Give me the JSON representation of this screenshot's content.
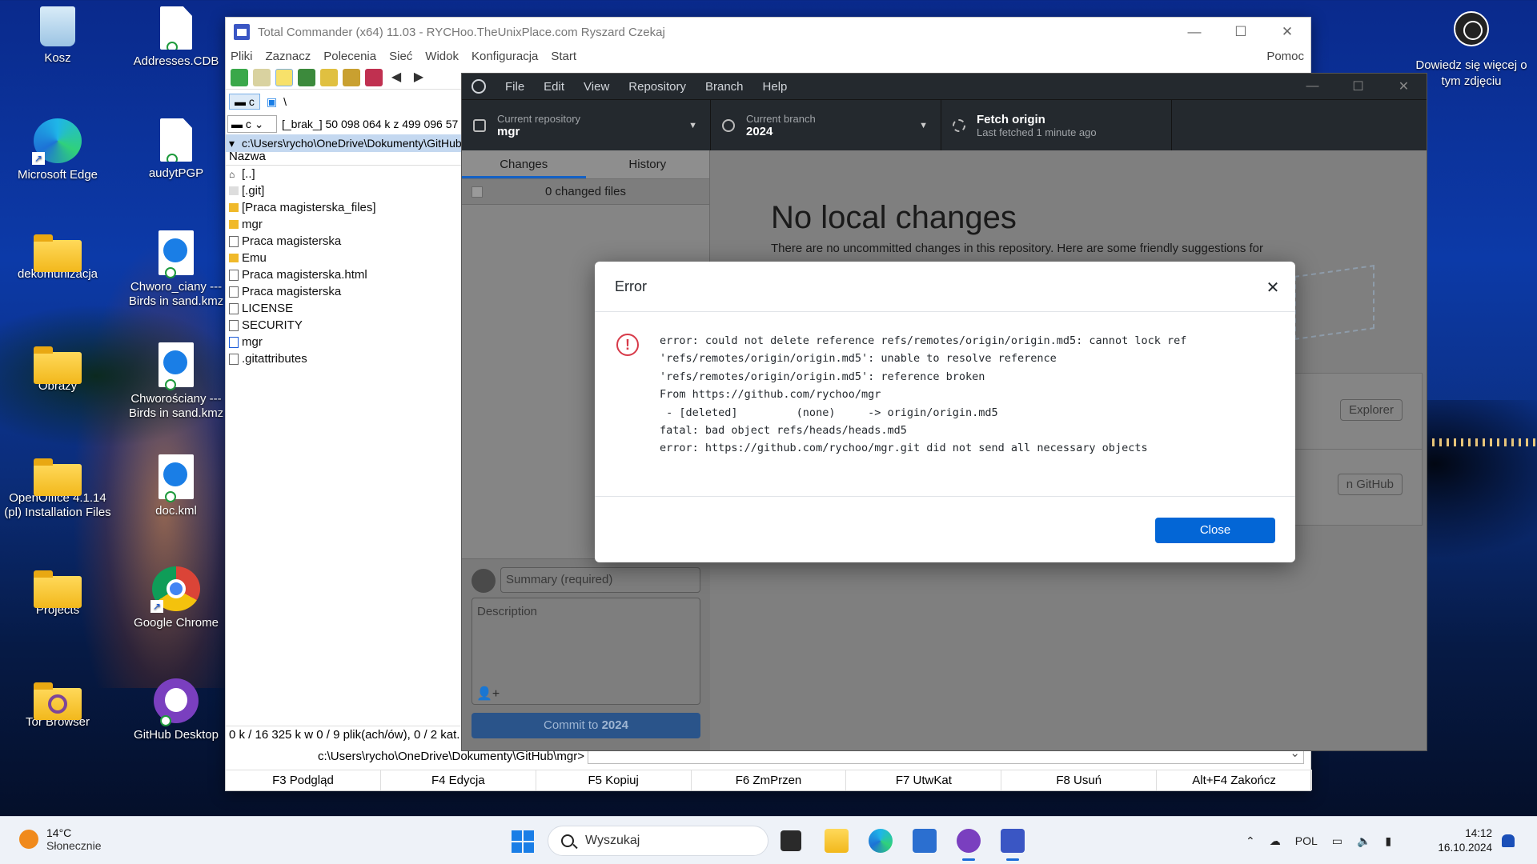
{
  "desktop": {
    "icons": [
      {
        "label": "Kosz",
        "icon": "recycle-bin-icon"
      },
      {
        "label": "Addresses.CDB",
        "icon": "document-icon"
      },
      {
        "label": "Microsoft Edge",
        "icon": "edge-icon"
      },
      {
        "label": "audytPGP",
        "icon": "document-icon"
      },
      {
        "label": "dekomunizacja",
        "icon": "folder-icon"
      },
      {
        "label": "Chworo_ciany --- Birds in sand.kmz",
        "icon": "kmz-icon"
      },
      {
        "label": "Obrazy",
        "icon": "folder-icon"
      },
      {
        "label": "Chworościany --- Birds in sand.kmz",
        "icon": "kmz-icon"
      },
      {
        "label": "OpenOffice 4.1.14 (pl) Installation Files",
        "icon": "folder-icon"
      },
      {
        "label": "doc.kml",
        "icon": "kml-icon"
      },
      {
        "label": "Projects",
        "icon": "folder-icon"
      },
      {
        "label": "Google Chrome",
        "icon": "chrome-icon"
      },
      {
        "label": "Tor Browser",
        "icon": "tor-folder-icon"
      },
      {
        "label": "GitHub Desktop",
        "icon": "github-icon"
      }
    ],
    "spotlight_text": "Dowiedz się więcej o tym zdjęciu"
  },
  "total_commander": {
    "title": "Total Commander (x64) 11.03 - RYCHoo.TheUnixPlace.com Ryszard Czekaj",
    "menu": [
      "Pliki",
      "Zaznacz",
      "Polecenia",
      "Sieć",
      "Widok",
      "Konfiguracja",
      "Start"
    ],
    "menu_right": "Pomoc",
    "drive_button": "c",
    "drive_root": "\\",
    "drive_select": "c",
    "drive_info": "[_brak_]  50 098 064 k z 499 096 57",
    "current_path": "c:\\Users\\rycho\\OneDrive\\Dokumenty\\GitHub\\mgr\\*.*",
    "column_name": "Nazwa",
    "files": [
      {
        "name": "[..]",
        "type": "up"
      },
      {
        "name": "[.git]",
        "type": "folder"
      },
      {
        "name": "[Praca magisterska_files]",
        "type": "folder"
      },
      {
        "name": "mgr",
        "type": "folder"
      },
      {
        "name": "Praca magisterska",
        "type": "file"
      },
      {
        "name": "Emu",
        "type": "folder"
      },
      {
        "name": "Praca magisterska.html",
        "type": "file"
      },
      {
        "name": "Praca magisterska",
        "type": "file"
      },
      {
        "name": "LICENSE",
        "type": "file"
      },
      {
        "name": "SECURITY",
        "type": "file"
      },
      {
        "name": "mgr",
        "type": "file"
      },
      {
        "name": ".gitattributes",
        "type": "file"
      }
    ],
    "status": "0 k / 16 325 k w 0 / 9 plik(ach/ów), 0 / 2 kat.",
    "cmdline_path": "c:\\Users\\rycho\\OneDrive\\Dokumenty\\GitHub\\mgr>",
    "fkeys": [
      "F3 Podgląd",
      "F4 Edycja",
      "F5 Kopiuj",
      "F6 ZmPrzen",
      "F7 UtwKat",
      "F8 Usuń",
      "Alt+F4 Zakończ"
    ]
  },
  "github_desktop": {
    "menu": [
      "File",
      "Edit",
      "View",
      "Repository",
      "Branch",
      "Help"
    ],
    "repo_label": "Current repository",
    "repo_value": "mgr",
    "branch_label": "Current branch",
    "branch_value": "2024",
    "fetch_label": "Fetch origin",
    "fetch_sub": "Last fetched 1 minute ago",
    "tab_changes": "Changes",
    "tab_history": "History",
    "changed_files": "0 changed files",
    "summary_placeholder": "Summary (required)",
    "description_placeholder": "Description",
    "commit_prefix": "Commit to",
    "commit_branch": "2024",
    "no_changes_title": "No local changes",
    "no_changes_sub": "There are no uncommitted changes in this repository. Here are some friendly suggestions for",
    "card1_button": "Explorer",
    "card2_button": "n GitHub"
  },
  "error_dialog": {
    "title": "Error",
    "message": "error: could not delete reference refs/remotes/origin/origin.md5: cannot lock ref\n'refs/remotes/origin/origin.md5': unable to resolve reference\n'refs/remotes/origin/origin.md5': reference broken\nFrom https://github.com/rychoo/mgr\n - [deleted]         (none)     -> origin/origin.md5\nfatal: bad object refs/heads/heads.md5\nerror: https://github.com/rychoo/mgr.git did not send all necessary objects",
    "close_button": "Close"
  },
  "taskbar": {
    "weather_temp": "14°C",
    "weather_desc": "Słonecznie",
    "search_placeholder": "Wyszukaj",
    "language": "POL",
    "time": "14:12",
    "date": "16.10.2024"
  }
}
